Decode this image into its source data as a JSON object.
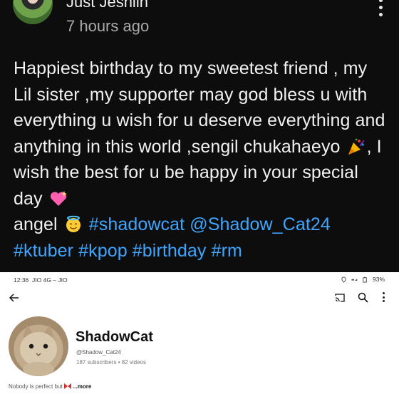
{
  "post": {
    "author": "Just Jeshiin",
    "time": "7 hours ago",
    "text_part1": "Happiest birthday to my sweetest friend , my Lil sister ,my supporter may god bless u with everything u wish for u deserve everything and anything in this world ,sengil chukahaeyo",
    "text_part2": ", I wish the best for u be happy in your special day",
    "text_part3": "angel",
    "hashtags_line1": "#shadowcat",
    "mention": "@Shadow_Cat24",
    "hashtags_line2": "#ktuber #kpop #birthday #rm"
  },
  "screenshot": {
    "status_time": "12:36",
    "carrier": "JIO 4G – JIO",
    "battery": "93%",
    "channel_name": "ShadowCat",
    "handle": "@Shadow_Cat24",
    "stats": "187 subscribers • 82 videos",
    "description": "Nobody is perfect but",
    "more_label": "...more"
  },
  "icons": {
    "party": "party-popper-icon",
    "heart": "sparkling-heart-icon",
    "angel": "angel-face-icon"
  },
  "colors": {
    "background": "#0d0d0d",
    "hashtag": "#3ea6ff"
  }
}
